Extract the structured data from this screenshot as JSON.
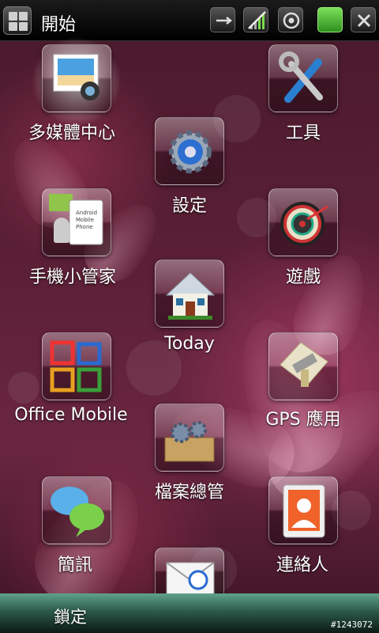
{
  "status_bar": {
    "title": "開始",
    "icons": [
      "start-menu-icon",
      "usb-sync-icon",
      "signal-icon",
      "volume-icon",
      "battery-icon",
      "close-icon"
    ]
  },
  "tiles": {
    "multimedia": {
      "label": "多媒體中心",
      "icon": "photo-camera-icon"
    },
    "tools": {
      "label": "工具",
      "icon": "tools-icon"
    },
    "settings": {
      "label": "設定",
      "icon": "gear-icon"
    },
    "phone_manager": {
      "label": "手機小管家",
      "icon": "android-phone-icon"
    },
    "games": {
      "label": "遊戲",
      "icon": "dartboard-icon"
    },
    "today": {
      "label": "Today",
      "icon": "house-icon"
    },
    "office": {
      "label": "Office Mobile",
      "icon": "office-icon"
    },
    "gps": {
      "label": "GPS 應用",
      "icon": "satellite-map-icon"
    },
    "file_manager": {
      "label": "檔案總管",
      "icon": "gears-box-icon"
    },
    "messaging": {
      "label": "簡訊",
      "icon": "chat-bubbles-icon"
    },
    "contacts": {
      "label": "連絡人",
      "icon": "contacts-card-icon"
    },
    "email": {
      "icon": "email-icon"
    }
  },
  "bottom_bar": {
    "lock_label": "鎖定"
  },
  "watermark": "#1243072",
  "colors": {
    "background": "#5a1f35",
    "status_bar": "#000000",
    "bottom_bar": "#2d5a4a",
    "battery": "#3fae2a"
  }
}
